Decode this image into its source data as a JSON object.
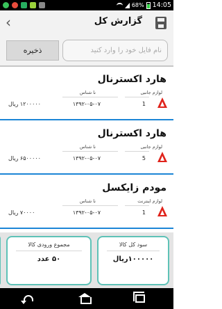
{
  "status_bar": {
    "time": "14:05",
    "battery_percent": "68%",
    "icons": [
      "whatsapp-icon",
      "chrome-icon",
      "sync-icon",
      "android-icon",
      "bug-icon"
    ]
  },
  "header": {
    "title": "گزارش کل"
  },
  "file_bar": {
    "save_label": "ذخیره",
    "filename_placeholder": "نام فایل خود را وارد کنید"
  },
  "items": [
    {
      "name": "هارد اکسترنال",
      "category_label": "لوازم جانبی",
      "serial_label": "نا شناس",
      "quantity": "1",
      "date": "۱۳۹۲-۰۵-۰۷",
      "price": "۱۲۰۰۰۰۰ ریال"
    },
    {
      "name": "هارد اکسترنال",
      "category_label": "لوازم جانبی",
      "serial_label": "نا شناس",
      "quantity": "5",
      "date": "۱۳۹۲-۰۵-۰۷",
      "price": "۶۵۰۰۰۰۰ ریال"
    },
    {
      "name": "مودم زایکسل",
      "category_label": "لوازم اینترنت",
      "serial_label": "نا شناس",
      "quantity": "1",
      "date": "۱۳۹۲-۰۵-۰۷",
      "price": "۷۰۰۰۰ ریال"
    }
  ],
  "summary": {
    "total_input_title": "مجموع ورودی کالا",
    "total_input_value": "۵۰ عدد",
    "total_profit_title": "سود کل کالا",
    "total_profit_value": "۱۰۰۰۰۰ریال"
  },
  "colors": {
    "accent_blue": "#1c85d6",
    "card_border": "#5ec2b7",
    "arrow_red": "#e0231b"
  }
}
